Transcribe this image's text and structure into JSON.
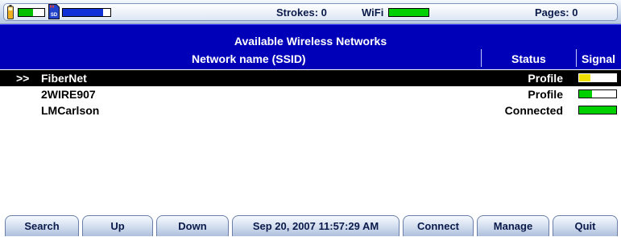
{
  "status_bar": {
    "battery_icon": "battery-icon",
    "memory_gauge": {
      "level": 0.55,
      "color": "#00c000"
    },
    "sd_icon": "sd-card-icon",
    "sd_label": "SD",
    "storage_gauge": {
      "level": 0.85,
      "color": "#1030d8"
    },
    "strokes": "Strokes: 0",
    "wifi_label": "WiFi",
    "wifi_gauge": {
      "level": 1.0,
      "color": "#00d000"
    },
    "pages": "Pages: 0"
  },
  "header": {
    "title": "Available Wireless Networks",
    "columns": {
      "ssid": "Network name (SSID)",
      "status": "Status",
      "signal": "Signal"
    },
    "background": "#0000b8"
  },
  "networks": [
    {
      "cursor": ">>",
      "ssid": "FiberNet",
      "status": "Profile",
      "signal": 0.3,
      "signal_color": "#f0e000",
      "selected": true
    },
    {
      "cursor": "",
      "ssid": "2WIRE907",
      "status": "Profile",
      "signal": 0.35,
      "signal_color": "#00d000",
      "selected": false
    },
    {
      "cursor": "",
      "ssid": "LMCarlson",
      "status": "Connected",
      "signal": 1.0,
      "signal_color": "#00d000",
      "selected": false
    }
  ],
  "buttons": {
    "search": "Search",
    "up": "Up",
    "down": "Down",
    "datetime": "Sep 20, 2007  11:57:29 AM",
    "connect": "Connect",
    "manage": "Manage",
    "quit": "Quit"
  }
}
